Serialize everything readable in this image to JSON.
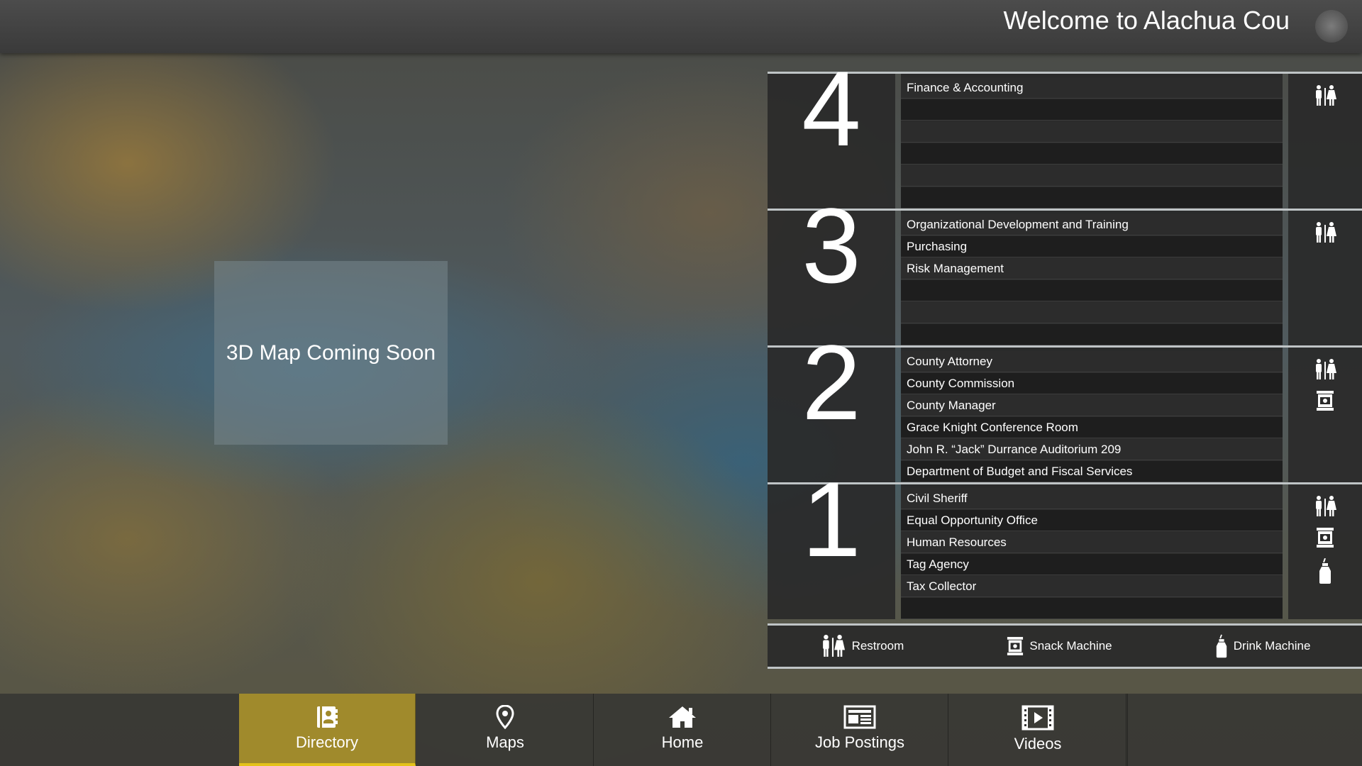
{
  "header": {
    "welcome_text": "Welcome to Alachua Cou"
  },
  "map": {
    "placeholder_text": "3D Map Coming Soon"
  },
  "floors": [
    {
      "number": "4",
      "rooms": [
        "Finance & Accounting",
        "",
        "",
        "",
        "",
        ""
      ],
      "amenities": [
        "restroom-icon"
      ]
    },
    {
      "number": "3",
      "rooms": [
        "Organizational Development and Training",
        "Purchasing",
        "Risk Management",
        "",
        "",
        ""
      ],
      "amenities": [
        "restroom-icon"
      ]
    },
    {
      "number": "2",
      "rooms": [
        "County Attorney",
        "County Commission",
        "County Manager",
        "Grace Knight Conference Room",
        "John R. “Jack” Durrance Auditorium 209",
        "Department of Budget and Fiscal Services"
      ],
      "amenities": [
        "restroom-icon",
        "snack-machine-icon"
      ]
    },
    {
      "number": "1",
      "rooms": [
        "Civil Sheriff",
        "Equal Opportunity Office",
        "Human Resources",
        "Tag Agency",
        "Tax Collector",
        ""
      ],
      "amenities": [
        "restroom-icon",
        "snack-machine-icon",
        "drink-machine-icon"
      ]
    }
  ],
  "legend": {
    "restroom": "Restroom",
    "snack": "Snack Machine",
    "drink": "Drink Machine"
  },
  "nav": {
    "directory": "Directory",
    "maps": "Maps",
    "home": "Home",
    "job_postings": "Job Postings",
    "videos": "Videos",
    "active": "Directory",
    "active_color": "#a08a2c"
  }
}
